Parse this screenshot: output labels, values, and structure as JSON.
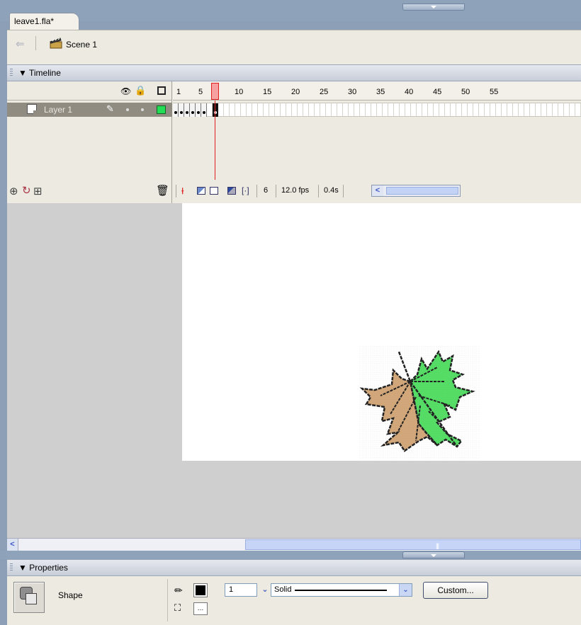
{
  "document": {
    "tab_title": "leave1.fla*"
  },
  "scene": {
    "label": "Scene 1"
  },
  "timeline": {
    "title": "Timeline",
    "ruler_numbers": [
      "1",
      "5",
      "10",
      "15",
      "20",
      "25",
      "30",
      "35",
      "40",
      "45",
      "50",
      "55"
    ],
    "layer": {
      "name": "Layer 1",
      "color": "#22dd55"
    },
    "keyframe_count": 6,
    "status": {
      "current_frame": "6",
      "frame_rate": "12.0 fps",
      "elapsed": "0.4s"
    }
  },
  "stage": {
    "leaf_colors": {
      "left_half": "#d2a77a",
      "right_half": "#55dd66",
      "outline": "#222222"
    }
  },
  "properties": {
    "title": "Properties",
    "selection_type": "Shape",
    "stroke_height": "1",
    "stroke_style": "Solid",
    "custom_button": "Custom..."
  },
  "icons": [
    "back-arrow-icon",
    "scene-icon",
    "eye-icon",
    "lock-icon",
    "outline-icon",
    "layer-icon",
    "pencil-icon",
    "add-layer-icon",
    "add-motion-guide-icon",
    "insert-folder-icon",
    "trash-icon",
    "center-frame-icon",
    "onion-skin-icon",
    "onion-outline-icon",
    "edit-multiple-frames-icon",
    "modify-markers-icon",
    "stroke-pencil-icon",
    "fill-bucket-icon"
  ]
}
